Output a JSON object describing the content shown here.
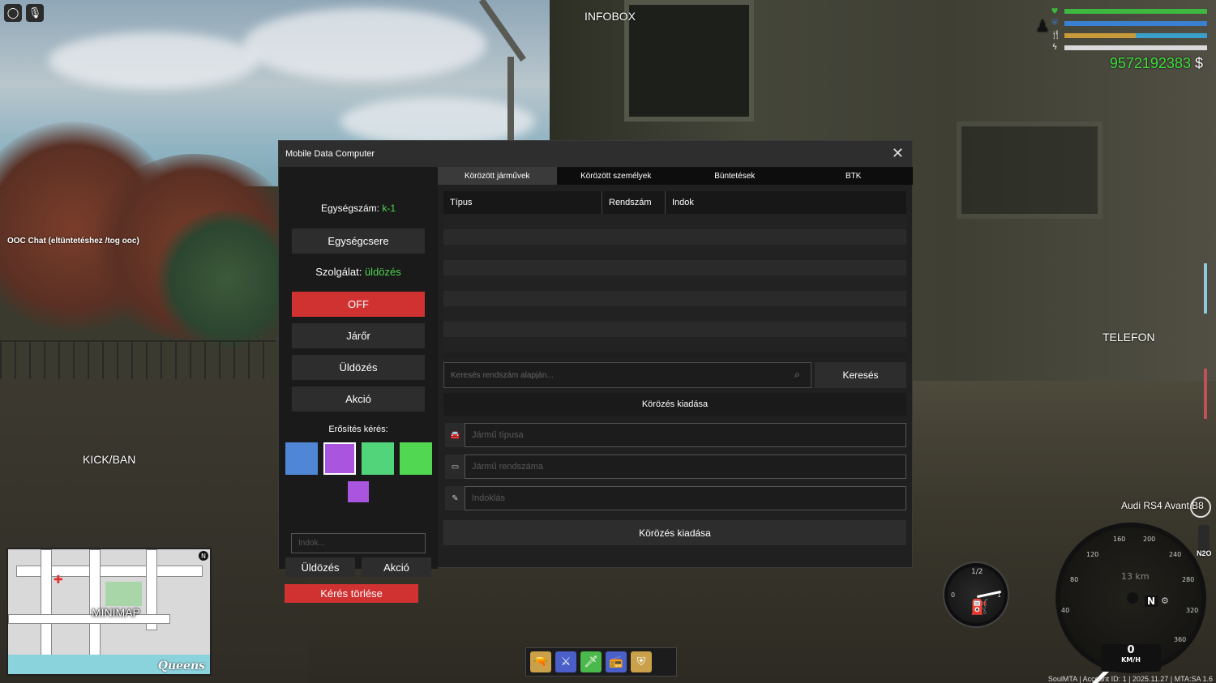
{
  "hud": {
    "infobox_label": "INFOBOX",
    "kickban_label": "KICK/BAN",
    "telefon_label": "TELEFON",
    "ooc_chat": "OOC Chat (eltüntetéshez /tog ooc)",
    "money": "9572192383",
    "currency": "$",
    "health_fraction": 1.0,
    "armor_fraction": 1.0,
    "hunger_fraction": 0.5,
    "thirst_fraction": 0.5,
    "stamina_fraction": 1.0,
    "colors": {
      "health": "#3fb83f",
      "armor": "#3a7fd0",
      "hunger": "#c99a3a",
      "thirst": "#3aa0c9",
      "stamina": "#d9d9d9",
      "money": "#3fe03f"
    },
    "icons": [
      "heart-icon",
      "shield-icon",
      "food-icon",
      "lightning-icon",
      "person-icon"
    ]
  },
  "toolbar": {
    "icons": [
      "circle-icon",
      "microphone-icon"
    ]
  },
  "minimap": {
    "label": "MINIMAP",
    "area": "Queens",
    "north": "N"
  },
  "hotbar": {
    "icons": [
      "pistol-icon",
      "rifle-icon",
      "knife-icon",
      "radio-icon",
      "badge-icon"
    ]
  },
  "vehicle": {
    "name": "Audi RS4 Avant B8",
    "speed": "0",
    "speed_unit": "KM/H",
    "odometer": "13 km",
    "gear": "N",
    "nitro": "N2O",
    "fuel_marks": [
      "0",
      "1/2",
      "1"
    ],
    "speed_ticks": [
      "40",
      "80",
      "120",
      "160",
      "200",
      "240",
      "280",
      "320",
      "360"
    ]
  },
  "footer": "SoulMTA | Account ID: 1 | 2025.11.27 | MTA:SA 1.6",
  "mdc": {
    "title": "Mobile Data Computer",
    "unit_label": "Egységszám:",
    "unit_value": "k-1",
    "change_unit": "Egységcsere",
    "duty_label": "Szolgálat:",
    "duty_value": "üldözés",
    "status_buttons": [
      "OFF",
      "Járőr",
      "Üldözés",
      "Akció"
    ],
    "backup_label": "Erősítés kérés:",
    "swatch_colors": [
      "#4f86d6",
      "#a955e0",
      "#52d47a",
      "#52d752",
      "#a955e0"
    ],
    "reason_placeholder": "Indok...",
    "request_buttons": [
      "Üldözés",
      "Akció"
    ],
    "delete_request": "Kérés törlése",
    "tabs": [
      "Körözött járművek",
      "Körözött személyek",
      "Büntetések",
      "BTK"
    ],
    "active_tab": 0,
    "table_headers": [
      "Típus",
      "Rendszám",
      "Indok"
    ],
    "search_placeholder": "Keresés rendszám alapján...",
    "search_button": "Keresés",
    "issue_header": "Körözés kiadása",
    "fields": [
      {
        "icon": "car-icon",
        "placeholder": "Jármű típusa"
      },
      {
        "icon": "plate-icon",
        "placeholder": "Jármű rendszáma"
      },
      {
        "icon": "pencil-icon",
        "placeholder": "Indoklás"
      }
    ],
    "submit": "Körözés kiadása"
  }
}
